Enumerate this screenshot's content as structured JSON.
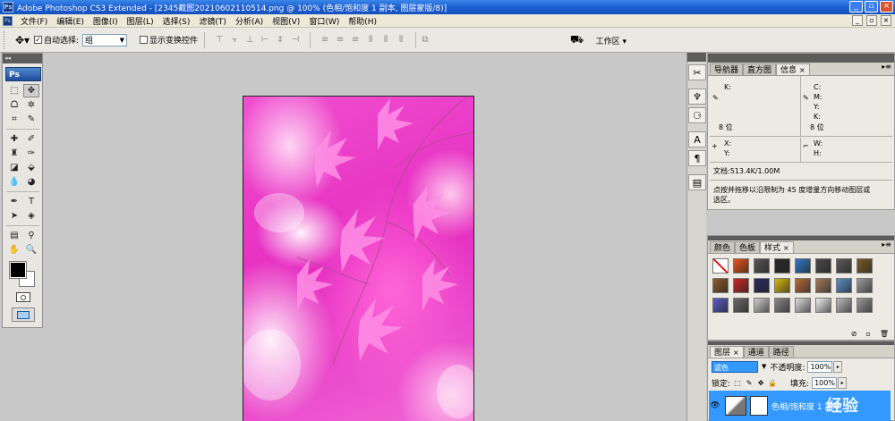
{
  "window": {
    "title": "Adobe Photoshop CS3 Extended - [2345截图20210602110514.png @ 100% (色相/饱和度 1 副本, 图层蒙版/8)]",
    "app_icon": "Ps"
  },
  "menubar": {
    "items": [
      "文件(F)",
      "编辑(E)",
      "图像(I)",
      "图层(L)",
      "选择(S)",
      "滤镜(T)",
      "分析(A)",
      "视图(V)",
      "窗口(W)",
      "帮助(H)"
    ]
  },
  "options": {
    "auto_select_label": "自动选择:",
    "auto_select_checked": true,
    "auto_select_value": "组",
    "show_transform_label": "显示变换控件",
    "show_transform_checked": false,
    "workspace_label": "工作区"
  },
  "toolbox": {
    "logo": "Ps"
  },
  "info_panel": {
    "tabs": [
      {
        "label": "导航器",
        "active": false
      },
      {
        "label": "直方图",
        "active": false
      },
      {
        "label": "信息",
        "active": true
      }
    ],
    "k_label": "K:",
    "c_label": "C:",
    "m_label": "M:",
    "y_label": "Y:",
    "k2_label": "K:",
    "bit_left": "8 位",
    "bit_right": "8 位",
    "x_label": "X:",
    "y2_label": "Y:",
    "w_label": "W:",
    "h_label": "H:",
    "doc_size": "文档:513.4K/1.00M",
    "hint_line1": "点按并拖移以沿限制为 45 度增量方向移动图层或",
    "hint_line2": "选区。"
  },
  "styles_panel": {
    "tabs": [
      {
        "label": "颜色",
        "active": false
      },
      {
        "label": "色板",
        "active": false
      },
      {
        "label": "样式",
        "active": true
      }
    ],
    "swatches": [
      "#ffffff",
      "#e8541a",
      "#555555",
      "#2a2a2a",
      "#2f78c8",
      "#4a4a4a",
      "#5a5a5a",
      "#7a5a2a",
      "#8a5a2a",
      "#c82828",
      "#2a2a60",
      "#d8b810",
      "#b86a3a",
      "#a07a5a",
      "#5a90c8",
      "#9a9a9a",
      "#5a5ac8",
      "#6a6a6a",
      "#cfcfcf",
      "#888888",
      "#dddddd",
      "#eeeeee",
      "#bbbbbb",
      "#999999"
    ]
  },
  "layers_panel": {
    "tabs": [
      {
        "label": "图层",
        "active": true
      },
      {
        "label": "通道",
        "active": false
      },
      {
        "label": "路径",
        "active": false
      }
    ],
    "blend_mode": "滤色",
    "opacity_label": "不透明度:",
    "opacity_value": "100%",
    "lock_label": "锁定:",
    "fill_label": "填充:",
    "fill_value": "100%",
    "layer_name": "色相/饱和度 1 副本"
  },
  "watermark": "经验"
}
